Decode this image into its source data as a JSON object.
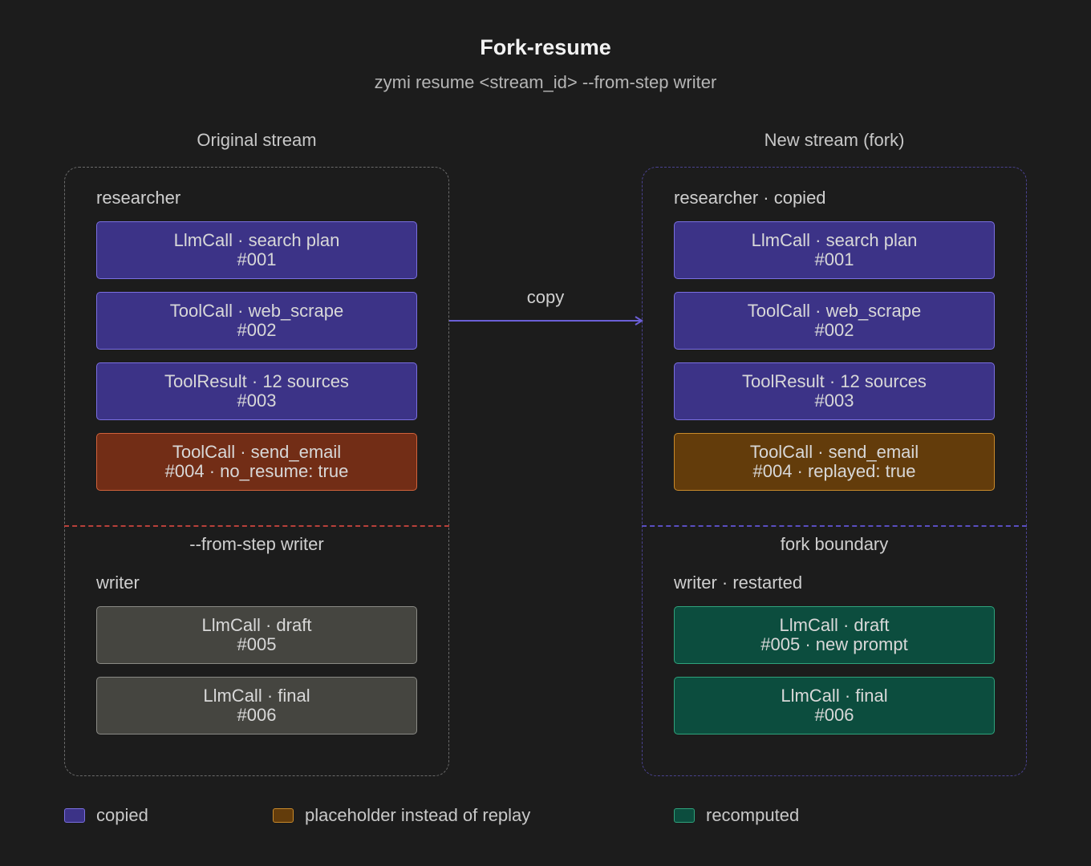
{
  "header": {
    "title": "Fork-resume",
    "subtitle": "zymi resume <stream_id> --from-step writer"
  },
  "original": {
    "heading": "Original stream",
    "group1_label": "researcher",
    "steps_top": [
      {
        "line1": "LlmCall · search plan",
        "line2": "#001",
        "kind": "copied"
      },
      {
        "line1": "ToolCall · web_scrape",
        "line2": "#002",
        "kind": "copied"
      },
      {
        "line1": "ToolResult · 12 sources",
        "line2": "#003",
        "kind": "copied"
      },
      {
        "line1": "ToolCall · send_email",
        "line2": "#004 · no_resume: true",
        "kind": "blocked"
      }
    ],
    "boundary_label": "--from-step writer",
    "group2_label": "writer",
    "steps_bottom": [
      {
        "line1": "LlmCall · draft",
        "line2": "#005",
        "kind": "stale"
      },
      {
        "line1": "LlmCall · final",
        "line2": "#006",
        "kind": "stale"
      }
    ]
  },
  "fork": {
    "heading": "New stream (fork)",
    "group1_label": "researcher · copied",
    "steps_top": [
      {
        "line1": "LlmCall · search plan",
        "line2": "#001",
        "kind": "copied"
      },
      {
        "line1": "ToolCall · web_scrape",
        "line2": "#002",
        "kind": "copied"
      },
      {
        "line1": "ToolResult · 12 sources",
        "line2": "#003",
        "kind": "copied"
      },
      {
        "line1": "ToolCall · send_email",
        "line2": "#004 · replayed: true",
        "kind": "placeholder"
      }
    ],
    "boundary_label": "fork boundary",
    "group2_label": "writer · restarted",
    "steps_bottom": [
      {
        "line1": "LlmCall · draft",
        "line2": "#005 · new prompt",
        "kind": "recomputed"
      },
      {
        "line1": "LlmCall · final",
        "line2": "#006",
        "kind": "recomputed"
      }
    ]
  },
  "arrow": {
    "label": "copy"
  },
  "legend": [
    {
      "label": "copied",
      "color": "#3c3387",
      "border": "#7a6fe0"
    },
    {
      "label": "placeholder instead of replay",
      "color": "#633c0b",
      "border": "#c98a2a"
    },
    {
      "label": "recomputed",
      "color": "#0c4d3e",
      "border": "#2fa37c"
    }
  ],
  "colors": {
    "background": "#1c1c1c",
    "copied": "#3c3387",
    "blocked": "#722d16",
    "placeholder": "#633c0b",
    "stale": "#454540",
    "recomputed": "#0c4d3e",
    "arrow": "#6b5fd6"
  }
}
